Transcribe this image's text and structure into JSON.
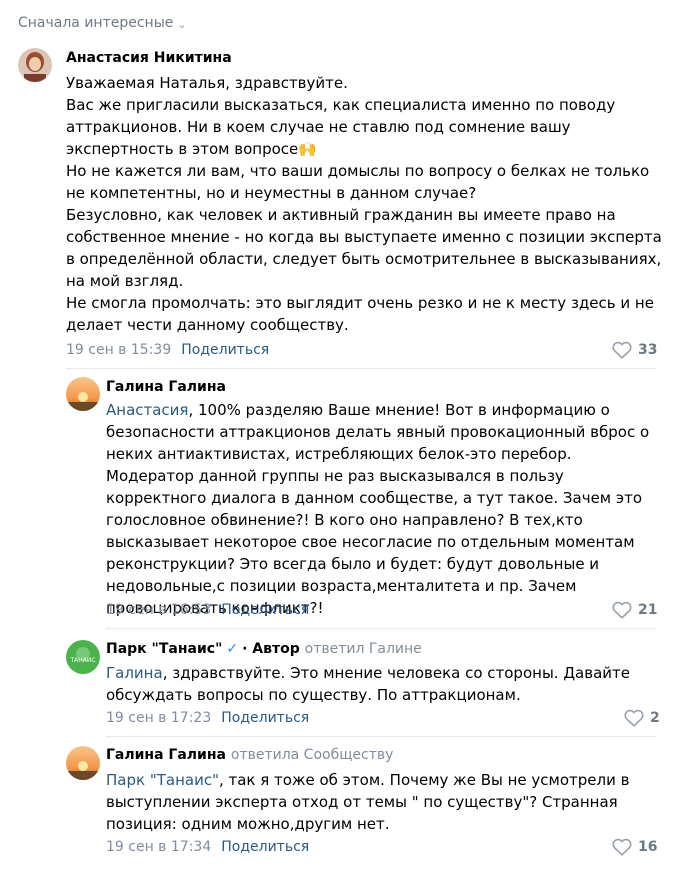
{
  "sort_label": "Сначала интересные",
  "comments": [
    {
      "author": "Анастасия Никитина",
      "paragraphs": [
        "Уважаемая Наталья, здравствуйте.",
        "Вас же пригласили высказаться, как специалиста именно по поводу аттракционов. Ни в коем случае не ставлю под сомнение вашу экспертность в этом вопросе",
        "Но не кажется ли вам, что ваши домыслы по вопросу о белках не только не компетентны, но и неуместны в данном случае?",
        "Безусловно, как человек и активный гражданин вы имеете право на собственное мнение - но когда вы выступаете именно с позиции эксперта в определённой области, следует быть осмотрительнее в высказываниях, на мой взгляд.",
        "Не смогла промолчать: это выглядит очень резко и не к месту здесь и не делает чести данному сообществу."
      ],
      "emoji": "🙌",
      "date": "19 сен в 15:39",
      "share": "Поделиться",
      "likes": "33"
    },
    {
      "author": "Галина Галина",
      "mention": "Анастасия",
      "text": ", 100% разделяю Ваше мнение! Вот в информацию о безопасности аттракционов делать явный провокационный вброс о неких антиактивистах, истребляющих белок-это перебор. Модератор данной группы не раз высказывался в пользу корректного диалога в данном сообществе, а тут такое. Зачем это голословное обвинение?! В кого оно направлено? В тех,кто высказывает некоторое свое несогласие по отдельным моментам реконструкции? Это всегда было и будет: будут довольные и недовольные,с позиции возраста,менталитета и пр. Зачем провоцировать конфликт?!",
      "date": "19 сен в 16:53",
      "share": "Поделиться",
      "likes": "21"
    },
    {
      "author": "Парк \"Танаис\"",
      "verified": "✓",
      "tag": "· Автор",
      "replied": "ответил Галине",
      "avatar_text": "ТАНАИС",
      "mention": "Галина",
      "text": ", здравствуйте. Это мнение человека со стороны. Давайте обсуждать вопросы по существу. По аттракционам.",
      "date": "19 сен в 17:23",
      "share": "Поделиться",
      "likes": "2"
    },
    {
      "author": "Галина Галина",
      "replied": "ответила Сообществу",
      "mention": "Парк \"Танаис\"",
      "text": ", так я тоже об этом. Почему же Вы не усмотрели в выступлении эксперта отход от темы \" по существу\"? Странная позиция: одним можно,другим нет.",
      "date": "19 сен в 17:34",
      "share": "Поделиться",
      "likes": "16"
    }
  ],
  "colors": {
    "link": "#2a5885",
    "meta": "#818c99",
    "separator": "#e7e8ec",
    "verified": "#2688eb",
    "park_avatar": "#4bb34b"
  },
  "icons": [
    "chevron-down-icon",
    "heart-icon",
    "verified-icon"
  ]
}
